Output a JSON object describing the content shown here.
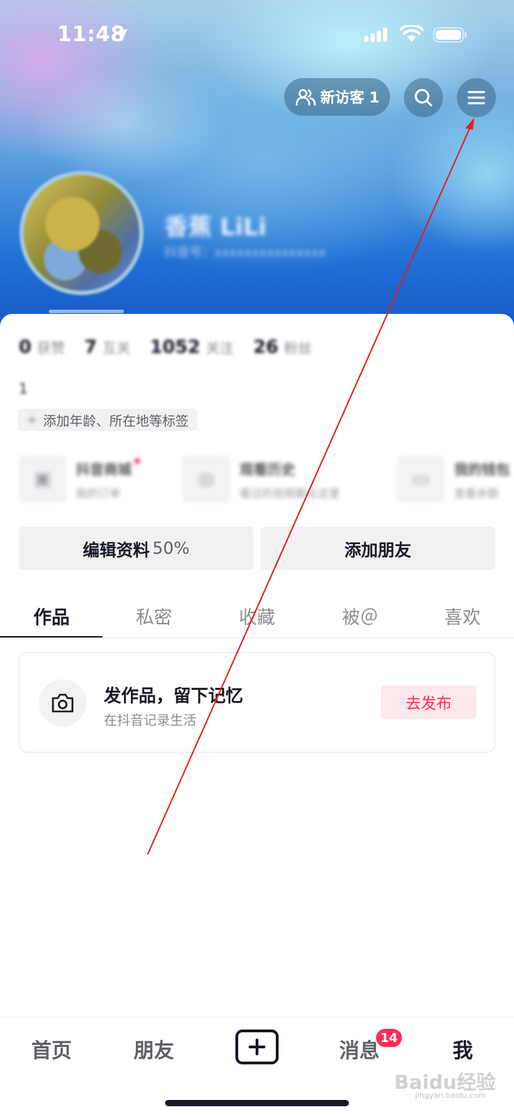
{
  "status_bar": {
    "time": "11:48"
  },
  "header": {
    "visitor_label": "新访客 1",
    "username": "香蕉 LiLi",
    "user_id": "抖音号：xxxxxxxxxxxxxxx"
  },
  "stats": [
    {
      "value": "0",
      "label": "获赞"
    },
    {
      "value": "7",
      "label": "互关"
    },
    {
      "value": "1052",
      "label": "关注"
    },
    {
      "value": "26",
      "label": "粉丝"
    }
  ],
  "bio": {
    "text": "1",
    "tag_plus": "+",
    "tag_text": "添加年龄、所在地等标签"
  },
  "services": [
    {
      "title": "抖音商城",
      "sub": "我的订单"
    },
    {
      "title": "观看历史",
      "sub": "看过的视频都在这里"
    },
    {
      "title": "我的钱包",
      "sub": "查看余额"
    }
  ],
  "actions": {
    "edit_label": "编辑资料",
    "edit_percent": "50%",
    "add_friend_label": "添加朋友"
  },
  "tabs": [
    "作品",
    "私密",
    "收藏",
    "被＠",
    "喜欢"
  ],
  "publish": {
    "title": "发作品，留下记忆",
    "subtitle": "在抖音记录生活",
    "button": "去发布"
  },
  "bottom_nav": {
    "home": "首页",
    "friends": "朋友",
    "messages": "消息",
    "messages_badge": "14",
    "me": "我"
  },
  "watermark": {
    "text": "Baidu经验",
    "url": "jingyan.baidu.com"
  },
  "colors": {
    "accent": "#fe2c55",
    "annotation": "#e0201c",
    "text": "#161823"
  }
}
